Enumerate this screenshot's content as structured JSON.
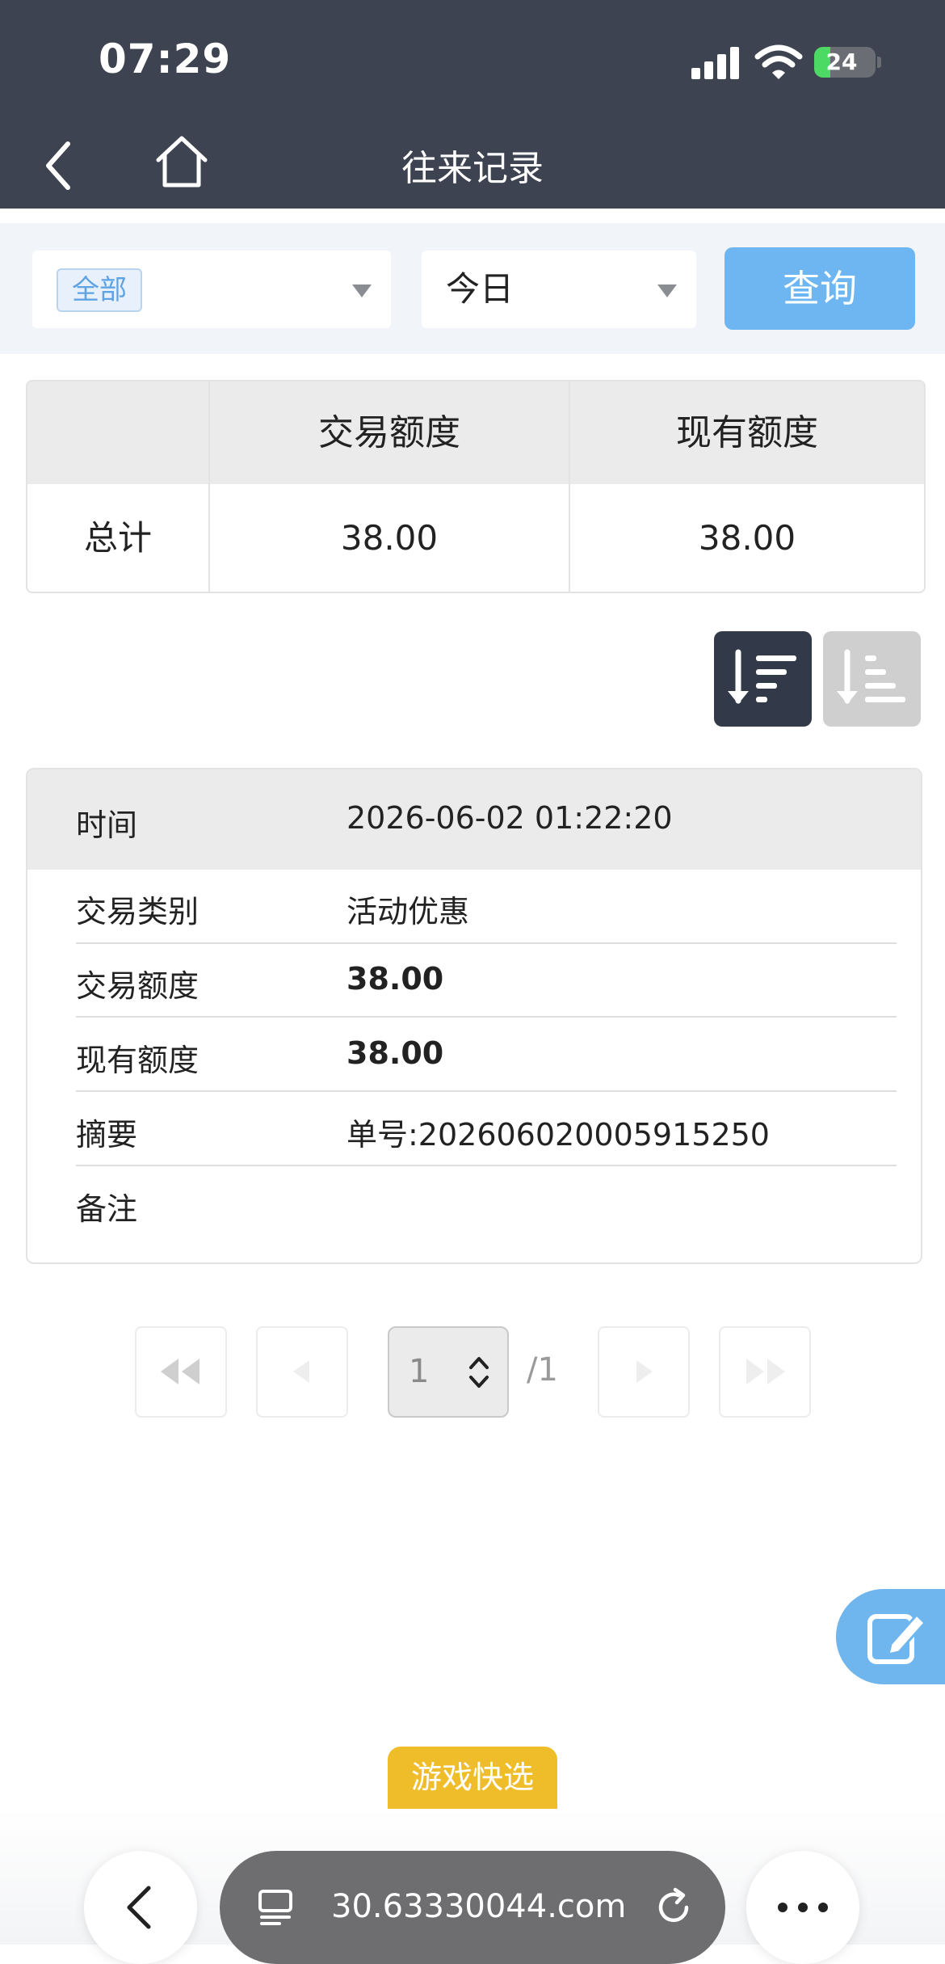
{
  "status_bar": {
    "time": "07:29",
    "battery": "24"
  },
  "header": {
    "title": "往来记录"
  },
  "filters": {
    "type_tag": "全部",
    "date_range": "今日",
    "query_button": "查询"
  },
  "summary": {
    "headers": [
      "",
      "交易额度",
      "现有额度"
    ],
    "row": {
      "label": "总计",
      "trade_amount": "38.00",
      "current_amount": "38.00"
    }
  },
  "record": {
    "time_label": "时间",
    "time_value": "2026-06-02 01:22:20",
    "type_label": "交易类别",
    "type_value": "活动优惠",
    "trade_label": "交易额度",
    "trade_value": "38.00",
    "current_label": "现有额度",
    "current_value": "38.00",
    "summary_label": "摘要",
    "summary_value": "单号:202606020005915250",
    "remark_label": "备注",
    "remark_value": ""
  },
  "pagination": {
    "current_page": "1",
    "total_label": "/1"
  },
  "game_quick_pick": "游戏快选",
  "browser": {
    "url": "30.63330044.com"
  },
  "colors": {
    "header_bg": "#3d4350",
    "filter_bg": "#f1f5f9",
    "query_button": "#6db6f1",
    "sort_active": "#323a4a",
    "sort_inactive": "#cfcfcf",
    "game_tab": "#f0bd2a",
    "fab": "#6fb5ee"
  },
  "icons": [
    "back-icon",
    "home-icon",
    "signal-icon",
    "wifi-icon",
    "battery-icon",
    "sort-descending-icon",
    "sort-ascending-icon",
    "first-page-icon",
    "prev-page-icon",
    "next-page-icon",
    "last-page-icon",
    "edit-icon",
    "tabs-icon",
    "reload-icon",
    "more-icon"
  ]
}
